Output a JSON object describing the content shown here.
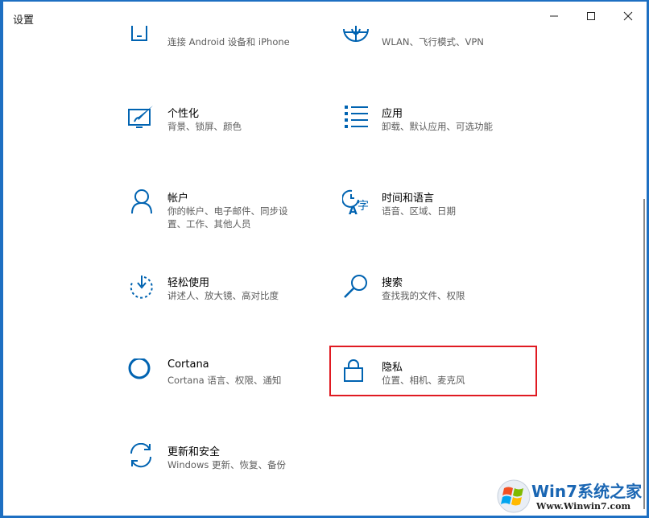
{
  "window": {
    "title": "设置"
  },
  "tiles": [
    {
      "name": "",
      "desc": "连接 Android 设备和 iPhone",
      "icon": "phone-icon"
    },
    {
      "name": "",
      "desc": "WLAN、飞行模式、VPN",
      "icon": "globe-icon"
    },
    {
      "name": "个性化",
      "desc": "背景、锁屏、颜色",
      "icon": "personalization-icon"
    },
    {
      "name": "应用",
      "desc": "卸载、默认应用、可选功能",
      "icon": "apps-icon"
    },
    {
      "name": "帐户",
      "desc": "你的帐户、电子邮件、同步设置、工作、其他人员",
      "icon": "person-icon"
    },
    {
      "name": "时间和语言",
      "desc": "语音、区域、日期",
      "icon": "time-language-icon"
    },
    {
      "name": "轻松使用",
      "desc": "讲述人、放大镜、高对比度",
      "icon": "ease-of-access-icon"
    },
    {
      "name": "搜索",
      "desc": "查找我的文件、权限",
      "icon": "search-icon"
    },
    {
      "name": "Cortana",
      "desc": "Cortana 语言、权限、通知",
      "icon": "cortana-icon"
    },
    {
      "name": "隐私",
      "desc": "位置、相机、麦克风",
      "icon": "lock-icon"
    },
    {
      "name": "更新和安全",
      "desc": "Windows 更新、恢复、备份",
      "icon": "update-icon"
    }
  ],
  "watermark": {
    "brand": "Win7系统之家",
    "url": "Www.Winwin7.com"
  },
  "colors": {
    "accent": "#0063b1",
    "highlight": "#e01a22"
  }
}
